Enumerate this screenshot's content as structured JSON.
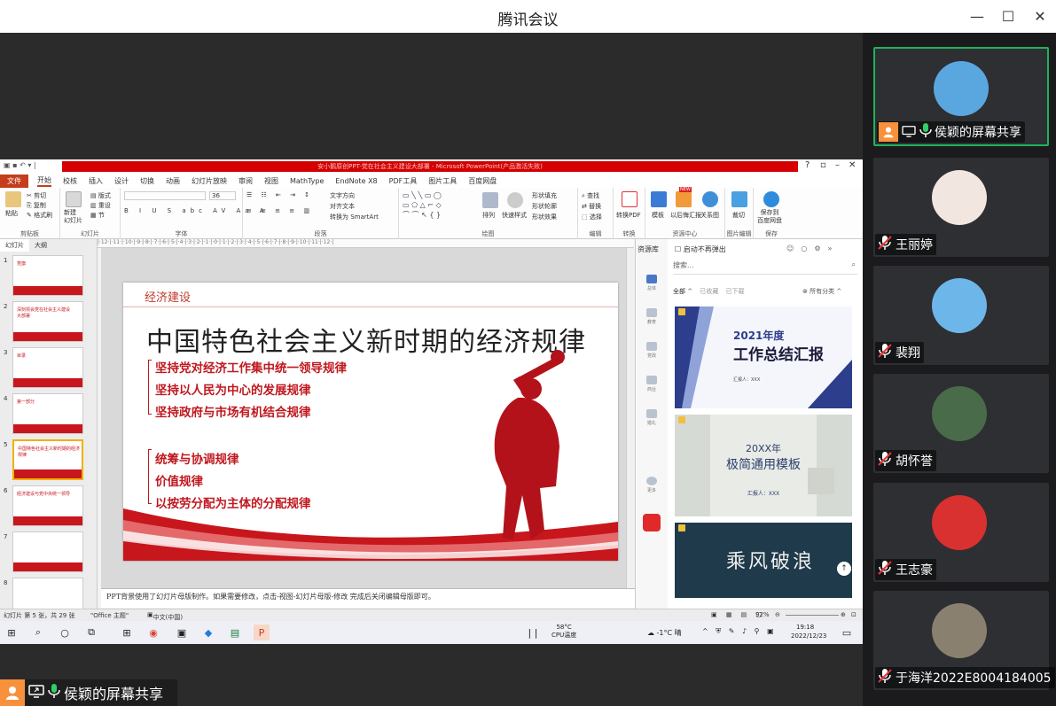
{
  "app": {
    "title": "腾讯会议"
  },
  "window_controls": {
    "minimize": "—",
    "maximize": "☐",
    "close": "✕"
  },
  "ppt": {
    "title": "安小鹅原创PPT-党在社会主义建设大部署 - Microsoft PowerPoint(产品激活失败)",
    "tabs": [
      "文件",
      "开始",
      "校核",
      "插入",
      "设计",
      "切换",
      "动画",
      "幻灯片放映",
      "审阅",
      "视图",
      "MathType",
      "EndNote X8",
      "PDF工具",
      "图片工具",
      "百度网盘"
    ],
    "ribbon": {
      "clipboard": {
        "paste": "粘贴",
        "cut": "剪切",
        "copy": "复制",
        "format_painter": "格式刷",
        "label": "剪贴板"
      },
      "slides": {
        "new_slide": "新建\n幻灯片",
        "layout": "版式",
        "reset": "重设",
        "section": "节",
        "label": "幻灯片"
      },
      "font": {
        "size": "36",
        "label": "字体"
      },
      "paragraph": {
        "text_direction": "文字方向",
        "align_text": "对齐文本",
        "smartart": "转换为 SmartArt",
        "label": "段落"
      },
      "drawing": {
        "arrange": "排列",
        "quick_styles": "快速样式",
        "shape_fill": "形状填充",
        "shape_outline": "形状轮廓",
        "shape_effects": "形状效果",
        "label": "绘图"
      },
      "editing": {
        "find": "查找",
        "replace": "替换",
        "select": "选择",
        "label": "编辑"
      },
      "convert": {
        "to_pdf": "转换PDF",
        "label": "转换"
      },
      "resources": {
        "template": "模板",
        "new": "NEW",
        "mail": "以后悔汇报",
        "relation": "关系图",
        "label": "资源中心"
      },
      "picture_edit": {
        "crop": "裁切",
        "label": "图片编辑"
      },
      "save": {
        "save_to": "保存到\n百度网盘",
        "label": "保存"
      }
    },
    "ruler": "|·12·|·11·|·10·|·9·|·8·|·7·|·6·|·5·|·4·|·3·|·2·|·1·|·0·|·1·|·2·|·3·|·4·|·5·|·6·|·7·|·8·|·9·|·10·|·11·|·12·|",
    "thumb_tabs": [
      "幻灯片",
      "大纲"
    ],
    "thumbs": [
      {
        "num": "1",
        "text": "党旗"
      },
      {
        "num": "2",
        "text": "深刻领会党在社会主义建设\n大部署"
      },
      {
        "num": "3",
        "text": "目录"
      },
      {
        "num": "4",
        "text": "第一部分"
      },
      {
        "num": "5",
        "text": "中国特色社会主义新时期的经济规律"
      },
      {
        "num": "6",
        "text": "经济建设与党中央统一领导"
      },
      {
        "num": "7",
        "text": ""
      },
      {
        "num": "8",
        "text": ""
      }
    ],
    "slide": {
      "section": "经济建设",
      "heading": "中国特色社会主义新时期的经济规律",
      "group1": [
        "坚持党对经济工作集中统一领导规律",
        "坚持以人民为中心的发展规律",
        "坚持政府与市场有机结合规律"
      ],
      "group2": [
        "统筹与协调规律",
        "价值规律",
        "以按劳分配为主体的分配规律"
      ]
    },
    "notes": "PPT背景使用了幻灯片母版制作。如果需要修改，点击-视图-幻灯片母版-修改 完成后关闭编辑母版即可。",
    "status": {
      "slide_pos": "幻灯片 第 5 张，共 29 张",
      "theme": "\"Office 主题\"",
      "lang": "中文(中国)",
      "zoom": "92%"
    }
  },
  "panel": {
    "title": "资源库",
    "startup_toggle": "启动不再弹出",
    "search_placeholder": "搜索...",
    "filters": [
      "全部",
      "已收藏",
      "已下载"
    ],
    "all_categories": "所有分类",
    "nav": [
      "总体",
      "教育",
      "党政",
      "商业",
      "婚礼",
      "更多"
    ],
    "cards": [
      {
        "title": "2021年度",
        "subtitle": "工作总结汇报",
        "sub2": "汇报人：XXX"
      },
      {
        "title": "20XX年",
        "subtitle": "极简通用模板",
        "sub2": "汇报人：XXX"
      },
      {
        "title": "乘风破浪"
      }
    ]
  },
  "taskbar": {
    "cpu": "58°C\nCPU温度",
    "weather": "-1°C 晴",
    "time": "19:18",
    "date": "2022/12/23"
  },
  "share_label": "侯颖的屏幕共享",
  "participants": [
    {
      "name": "侯颖的屏幕共享",
      "active": true,
      "avatar_color": "#5aa7e0",
      "muted": false
    },
    {
      "name": "王丽婷",
      "active": false,
      "avatar_color": "#f2e6e0",
      "muted": true
    },
    {
      "name": "裴翔",
      "active": false,
      "avatar_color": "#6cb6ea",
      "muted": true
    },
    {
      "name": "胡怀誉",
      "active": false,
      "avatar_color": "#4a6b4a",
      "muted": true
    },
    {
      "name": "王志豪",
      "active": false,
      "avatar_color": "#d93030",
      "muted": true
    },
    {
      "name": "于海洋2022E8004184005",
      "active": false,
      "avatar_color": "#8a8070",
      "muted": true
    }
  ]
}
